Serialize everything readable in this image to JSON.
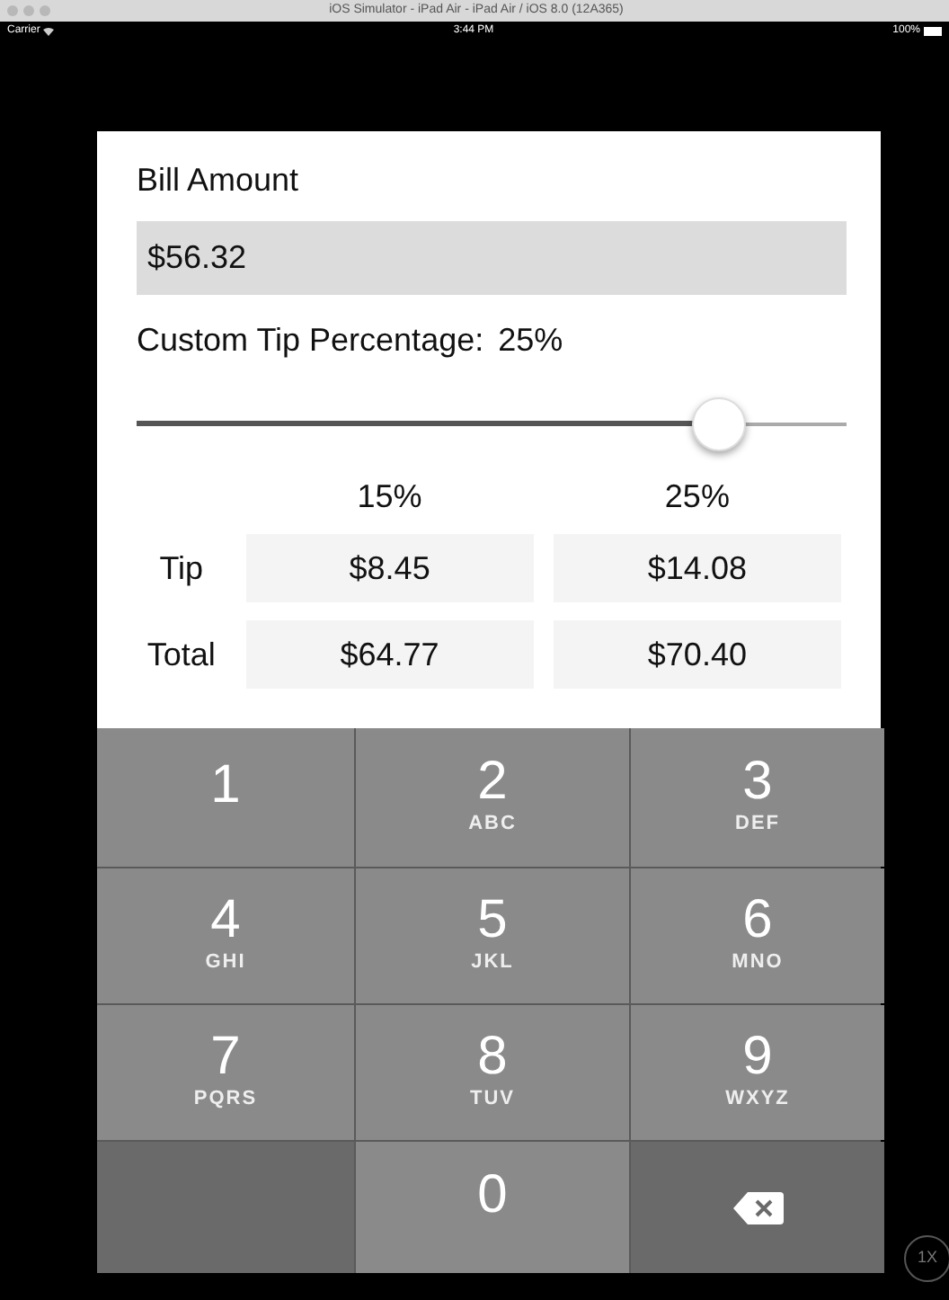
{
  "window": {
    "title": "iOS Simulator - iPad Air - iPad Air / iOS 8.0 (12A365)"
  },
  "status_bar": {
    "carrier": "Carrier",
    "time": "3:44 PM",
    "battery": "100%"
  },
  "bill": {
    "label": "Bill Amount",
    "value": "$56.32"
  },
  "custom_tip": {
    "label": "Custom Tip Percentage:",
    "value": "25%",
    "level": 0.82
  },
  "table": {
    "columns": [
      "15%",
      "25%"
    ],
    "rows": [
      {
        "label": "Tip",
        "values": [
          "$8.45",
          "$14.08"
        ]
      },
      {
        "label": "Total",
        "values": [
          "$64.77",
          "$70.40"
        ]
      }
    ]
  },
  "keypad": [
    {
      "kind": "digit",
      "digit": "1"
    },
    {
      "kind": "digit",
      "digit": "2",
      "letters": "ABC"
    },
    {
      "kind": "digit",
      "digit": "3",
      "letters": "DEF"
    },
    {
      "kind": "digit",
      "digit": "4",
      "letters": "GHI"
    },
    {
      "kind": "digit",
      "digit": "5",
      "letters": "JKL"
    },
    {
      "kind": "digit",
      "digit": "6",
      "letters": "MNO"
    },
    {
      "kind": "digit",
      "digit": "7",
      "letters": "PQRS"
    },
    {
      "kind": "digit",
      "digit": "8",
      "letters": "TUV"
    },
    {
      "kind": "digit",
      "digit": "9",
      "letters": "WXYZ"
    },
    {
      "kind": "blank"
    },
    {
      "kind": "digit",
      "digit": "0"
    },
    {
      "kind": "delete"
    }
  ],
  "scale_badge": "1X"
}
